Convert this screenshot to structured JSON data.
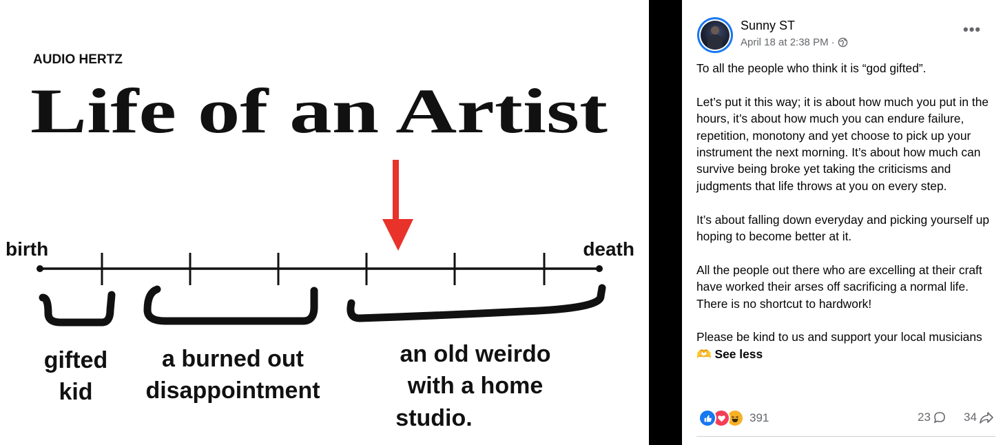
{
  "meme": {
    "watermark": "AUDIO HERTZ",
    "title": "Life of an Artist",
    "label_start": "birth",
    "label_end": "death",
    "groups": [
      {
        "line1": "gifted",
        "line2": "kid",
        "line3": ""
      },
      {
        "line1": "a burned out",
        "line2": "disappointment",
        "line3": ""
      },
      {
        "line1": "an old weirdo",
        "line2": "with a home",
        "line3": "studio."
      }
    ],
    "colors": {
      "arrow": "#e8322a",
      "ink": "#111111"
    }
  },
  "post": {
    "author": "Sunny ST",
    "date": "April 18 at 2:38 PM",
    "separator": "·",
    "privacy_icon": "globe-icon",
    "more_label": "•••",
    "paragraphs": [
      "To all the people who think it is “god gifted”.",
      "Let’s put it this way; it is about how much you put in the hours, it’s about how much you can endure failure, repetition, monotony and yet choose to pick up your instrument the next morning. It’s about how much can survive being broke yet taking the criticisms and judgments that life throws at you on every step.",
      "It’s about falling down everyday and picking yourself up hoping to become better at it.",
      "All the people out there who are excelling at their craft have worked their arses off sacrificing a normal life. There is no shortcut to hardwork!"
    ],
    "last_paragraph": "Please be kind to us and support your local musicians",
    "last_emoji": "🫶",
    "see_less": "See less",
    "reactions": {
      "icons": [
        "like-icon",
        "love-icon",
        "haha-icon"
      ],
      "count": "391"
    },
    "comments_count": "23",
    "shares_count": "34",
    "colors": {
      "like": "#1877f2",
      "love": "#f33e58",
      "haha": "#f7b125",
      "meta": "#65676b"
    }
  }
}
